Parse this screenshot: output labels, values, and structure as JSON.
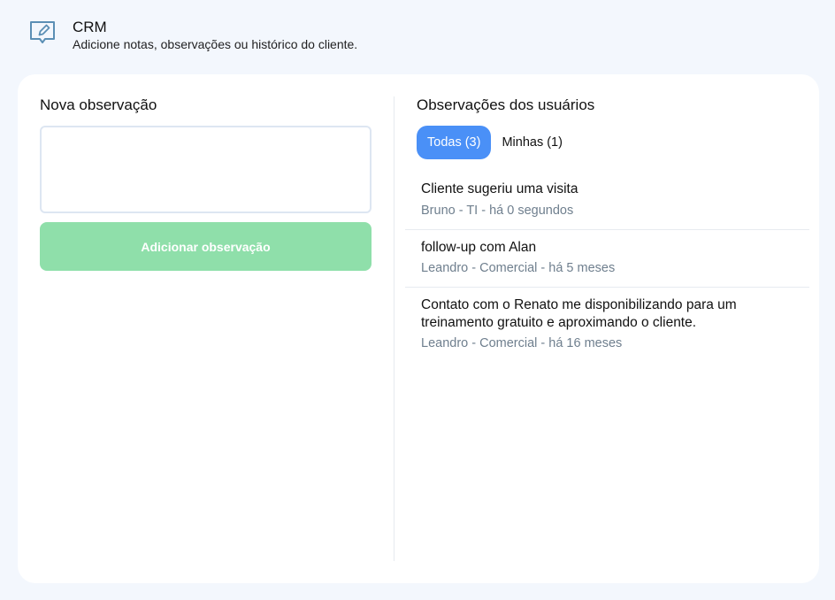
{
  "header": {
    "title": "CRM",
    "subtitle": "Adicione notas, observações ou histórico do cliente.",
    "icon": "edit-note-icon"
  },
  "left": {
    "title": "Nova observação",
    "textarea_value": "",
    "textarea_placeholder": "",
    "button_label": "Adicionar observação"
  },
  "right": {
    "title": "Observações dos usuários",
    "tabs": [
      {
        "label": "Todas (3)",
        "active": true
      },
      {
        "label": "Minhas (1)",
        "active": false
      }
    ],
    "items": [
      {
        "text": "Cliente sugeriu uma visita",
        "meta": "Bruno - TI - há 0 segundos"
      },
      {
        "text": "follow-up com Alan",
        "meta": "Leandro - Comercial - há 5 meses"
      },
      {
        "text": "Contato com o Renato me disponibilizando para um treinamento gratuito e aproximando o cliente.",
        "meta": "Leandro - Comercial - há 16 meses"
      }
    ]
  },
  "colors": {
    "accent": "#4a90f7",
    "button_disabled": "#8fdfaa",
    "meta_text": "#6f7f8e",
    "background": "#f3f7fd"
  }
}
